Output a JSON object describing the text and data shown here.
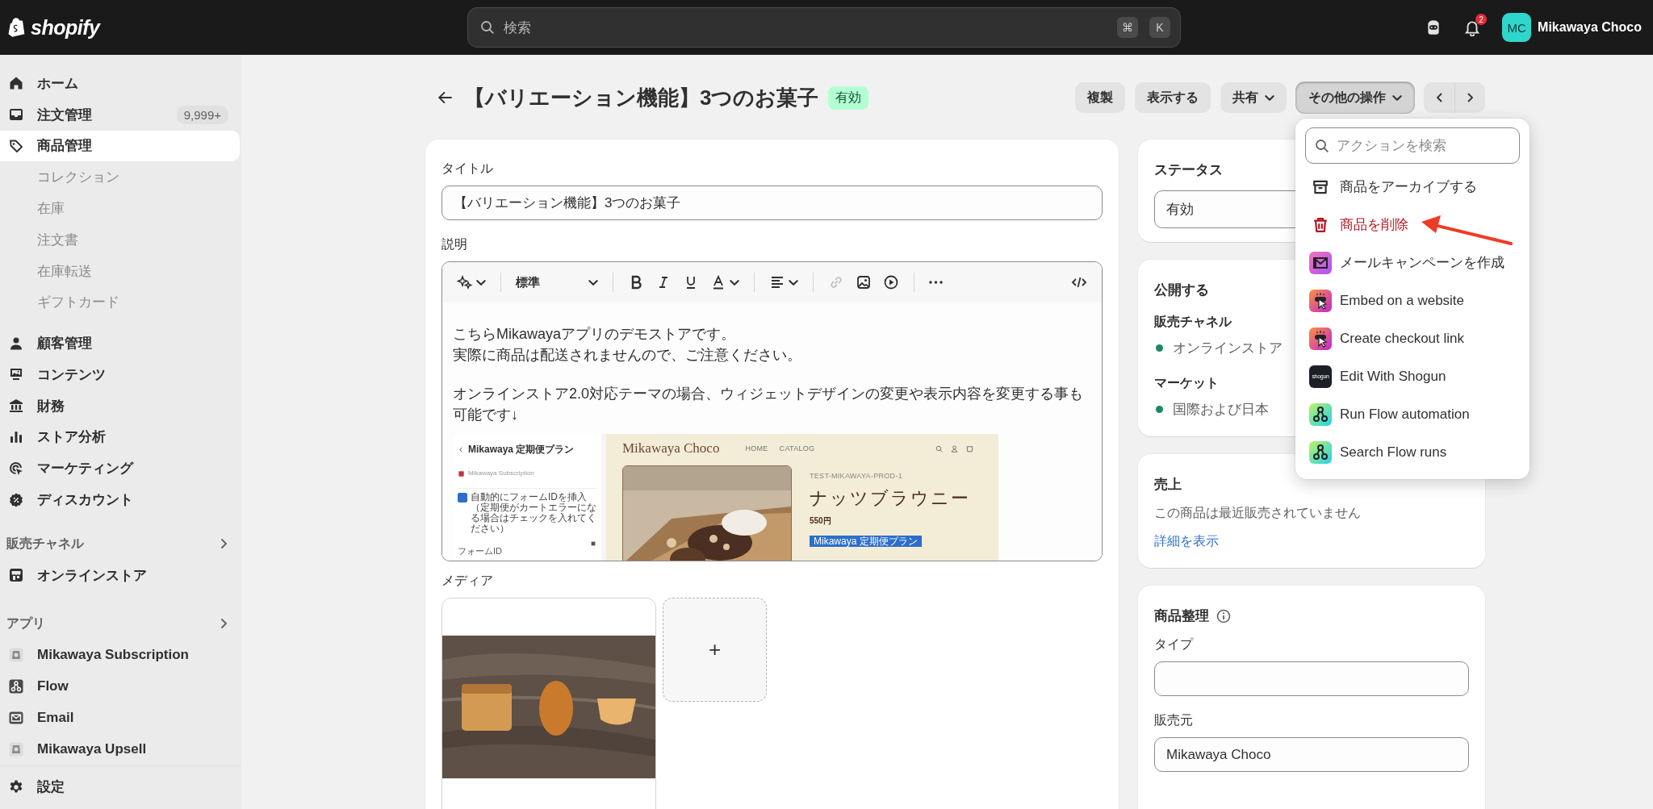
{
  "topbar": {
    "logo_text": "shopify",
    "search": {
      "placeholder": "検索",
      "shortcut": [
        "⌘",
        "K"
      ]
    },
    "notification_count": "2",
    "avatar_initials": "MC",
    "store_name": "Mikawaya Choco"
  },
  "sidebar": {
    "main_items": [
      {
        "label": "ホーム",
        "selected": false
      },
      {
        "label": "注文管理",
        "badge": "9,999+",
        "selected": false
      },
      {
        "label": "商品管理",
        "selected": true,
        "children": [
          {
            "label": "コレクション"
          },
          {
            "label": "在庫"
          },
          {
            "label": "注文書"
          },
          {
            "label": "在庫転送"
          },
          {
            "label": "ギフトカード"
          }
        ]
      },
      {
        "label": "顧客管理",
        "selected": false
      },
      {
        "label": "コンテンツ",
        "selected": false
      },
      {
        "label": "財務",
        "selected": false
      },
      {
        "label": "ストア分析",
        "selected": false
      },
      {
        "label": "マーケティング",
        "selected": false
      },
      {
        "label": "ディスカウント",
        "selected": false
      }
    ],
    "sections": [
      {
        "heading": "販売チャネル",
        "items": [
          {
            "label": "オンラインストア",
            "selected": false
          }
        ]
      },
      {
        "heading": "アプリ",
        "items": [
          {
            "label": "Mikawaya Subscription",
            "selected": false
          },
          {
            "label": "Flow",
            "selected": false
          },
          {
            "label": "Email",
            "selected": false
          },
          {
            "label": "Mikawaya Upsell",
            "selected": false
          }
        ]
      }
    ],
    "footer": {
      "label": "設定"
    }
  },
  "header": {
    "title": "【バリエーション機能】3つのお菓子",
    "status_badge": "有効",
    "buttons": [
      {
        "label": "複製",
        "dropdown": false,
        "pressed": false
      },
      {
        "label": "表示する",
        "dropdown": false,
        "pressed": false
      },
      {
        "label": "共有",
        "dropdown": true,
        "pressed": false
      },
      {
        "label": "その他の操作",
        "dropdown": true,
        "pressed": true
      }
    ]
  },
  "product": {
    "title_label": "タイトル",
    "title_value": "【バリエーション機能】3つのお菓子",
    "description_label": "説明",
    "text_style": "標準",
    "description": [
      [
        "こちらMikawayaアプリのデモストアです。",
        "実際に商品は配送されませんので、ご注意ください。"
      ],
      [
        "オンラインストア2.0対応テーマの場合、ウィジェットデザインの変更や表示内容を変更する事も可能です↓"
      ]
    ],
    "embedded_screenshot": {
      "panel_title": "Mikawaya 定期便プラン",
      "panel_app": "Mikawaya Subscription",
      "checkbox_label": "自動的にフォームIDを挿入（定期便がカートエラーになる場合はチェックを入れてください）",
      "checkbox_checked": true,
      "form_id_label": "フォームID",
      "store_name": "Mikawaya Choco",
      "nav": [
        "HOME",
        "CATALOG"
      ],
      "sku": "TEST-MIKAWAYA-PROD-1",
      "product_name": "ナッツブラウニー",
      "price": "550円",
      "widget_tag": "Mikawaya 定期便プラン"
    },
    "media_label": "メディア",
    "media": [
      {
        "kind": "picture"
      },
      {
        "kind": "add",
        "label": "+"
      }
    ]
  },
  "status_card": {
    "title": "ステータス",
    "value": "有効"
  },
  "publish_card": {
    "title": "公開する",
    "channels_heading": "販売チャネル",
    "channels": [
      "オンラインストア"
    ],
    "markets_heading": "マーケット",
    "markets": [
      "国際および日本"
    ]
  },
  "sales_card": {
    "title": "売上",
    "text": "この商品は最近販売されていません",
    "link": "詳細を表示"
  },
  "organization_card": {
    "title": "商品整理",
    "type_label": "タイプ",
    "vendor_label": "販売元",
    "vendor_value": "Mikawaya Choco"
  },
  "action_menu": {
    "search_placeholder": "アクションを検索",
    "items": [
      {
        "kind": "archive",
        "label": "商品をアーカイブする"
      },
      {
        "kind": "delete",
        "label": "商品を削除"
      },
      {
        "kind": "mail",
        "label": "メールキャンペーンを作成"
      },
      {
        "kind": "embed",
        "label": "Embed on a website"
      },
      {
        "kind": "embed",
        "label": "Create checkout link"
      },
      {
        "kind": "shogun",
        "label": "Edit With Shogun",
        "logo_text": "shogun"
      },
      {
        "kind": "flow",
        "label": "Run Flow automation"
      },
      {
        "kind": "flow",
        "label": "Search Flow runs"
      }
    ]
  }
}
